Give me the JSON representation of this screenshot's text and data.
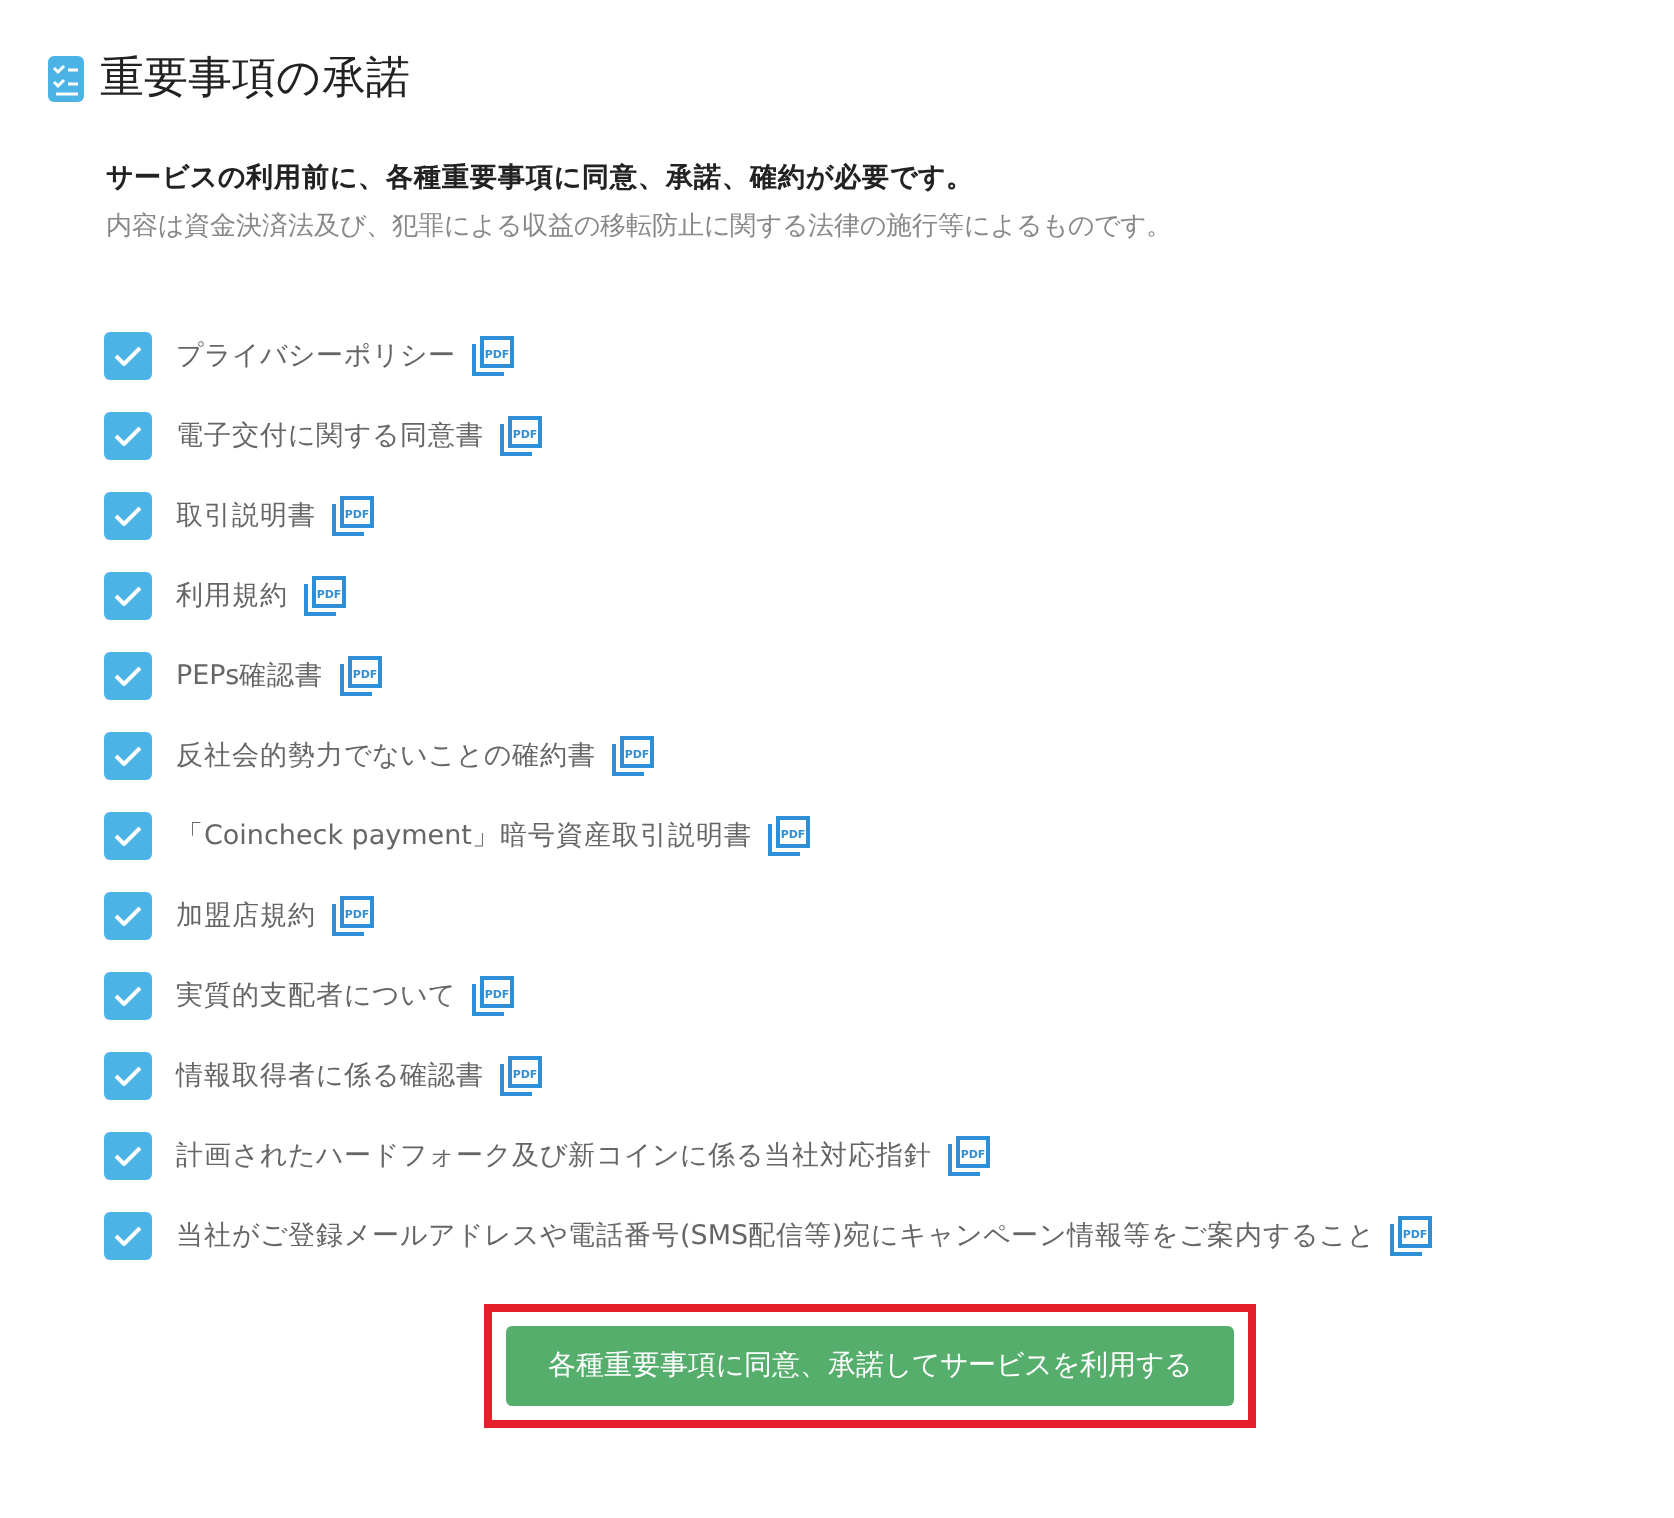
{
  "title": "重要事項の承諾",
  "intro": {
    "lead": "サービスの利用前に、各種重要事項に同意、承諾、確約が必要です。",
    "note": "内容は資金決済法及び、犯罪による収益の移転防止に関する法律の施行等によるものです。"
  },
  "agreements": [
    {
      "label": "プライバシーポリシー",
      "checked": true,
      "icon_text": "PDF"
    },
    {
      "label": "電子交付に関する同意書",
      "checked": true,
      "icon_text": "PDF"
    },
    {
      "label": "取引説明書",
      "checked": true,
      "icon_text": "PDF"
    },
    {
      "label": "利用規約",
      "checked": true,
      "icon_text": "PDF"
    },
    {
      "label": "PEPs確認書",
      "checked": true,
      "icon_text": "PDF"
    },
    {
      "label": "反社会的勢力でないことの確約書",
      "checked": true,
      "icon_text": "PDF"
    },
    {
      "label": "「Coincheck payment」暗号資産取引説明書",
      "checked": true,
      "icon_text": "PDF"
    },
    {
      "label": "加盟店規約",
      "checked": true,
      "icon_text": "PDF"
    },
    {
      "label": "実質的支配者について",
      "checked": true,
      "icon_text": "PDF"
    },
    {
      "label": "情報取得者に係る確認書",
      "checked": true,
      "icon_text": "PDF"
    },
    {
      "label": "計画されたハードフォーク及び新コインに係る当社対応指針",
      "checked": true,
      "icon_text": "PDF"
    },
    {
      "label": "当社がご登録メールアドレスや電話番号(SMS配信等)宛にキャンペーン情報等をご案内すること",
      "checked": true,
      "icon_text": "PDF"
    }
  ],
  "submit_button": {
    "label": "各種重要事項に同意、承諾してサービスを利用する",
    "highlighted": true
  }
}
